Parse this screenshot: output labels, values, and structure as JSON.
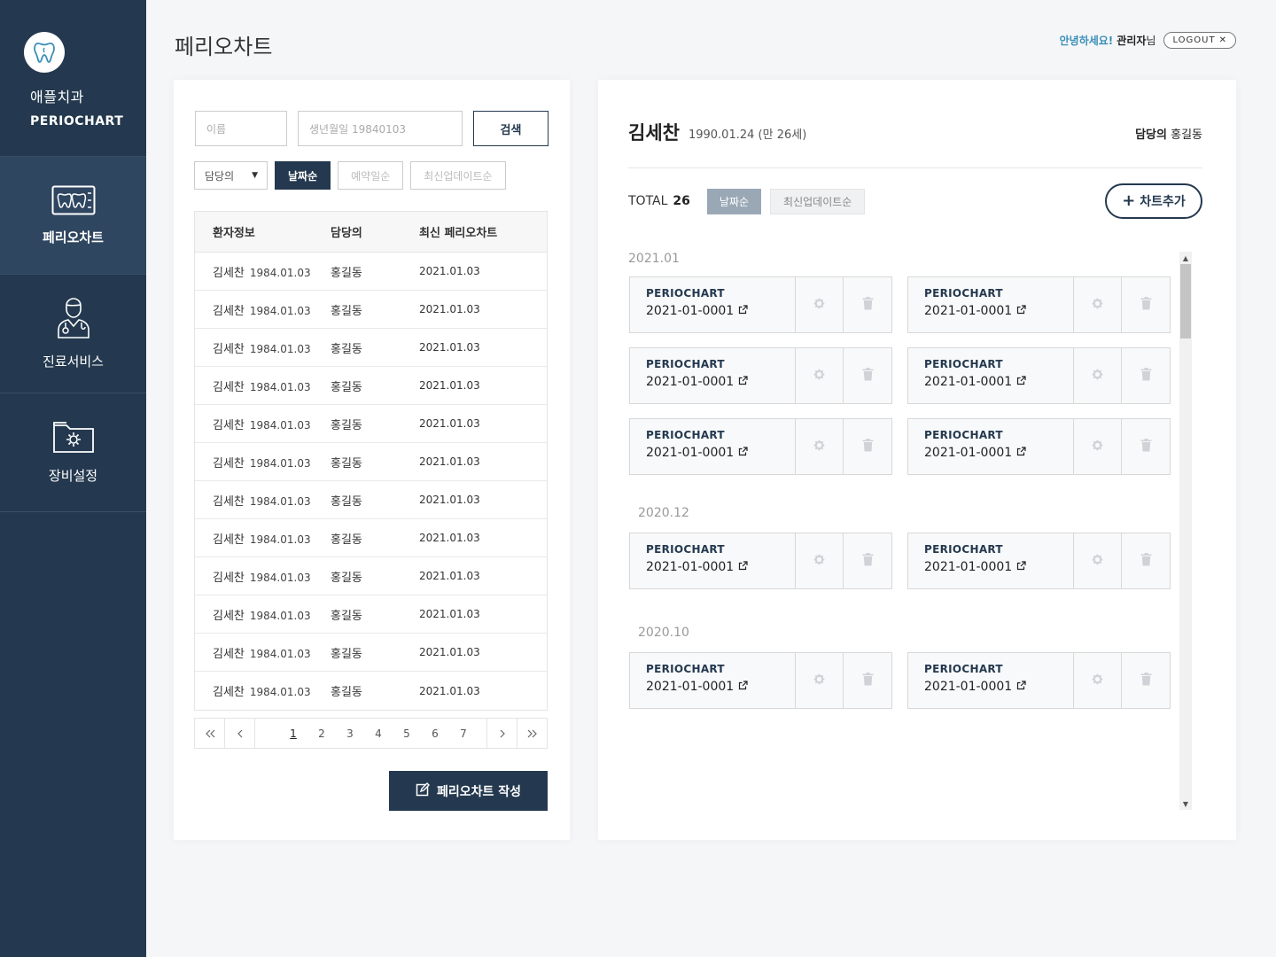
{
  "sidebar": {
    "brand_name": "애플치과",
    "brand_sub": "PERIOCHART",
    "items": [
      {
        "label": "페리오차트",
        "icon": "teeth-chart-icon"
      },
      {
        "label": "진료서비스",
        "icon": "doctor-icon"
      },
      {
        "label": "장비설정",
        "icon": "settings-folder-icon"
      }
    ]
  },
  "header": {
    "title": "페리오차트",
    "greeting": "안녕하세요!",
    "user_name": "관리자",
    "user_suffix": "님",
    "logout": "LOGOUT"
  },
  "search": {
    "name_placeholder": "이름",
    "birth_placeholder": "생년월일 19840103",
    "search_label": "검색",
    "doctor_select": "담당의",
    "sort_date": "날짜순",
    "sort_appointment": "예약일순",
    "sort_updated": "최신업데이트순"
  },
  "table": {
    "headers": [
      "환자정보",
      "담당의",
      "최신 페리오차트"
    ],
    "rows": [
      {
        "name": "김세찬",
        "birth": "1984.01.03",
        "doctor": "홍길동",
        "latest": "2021.01.03"
      },
      {
        "name": "김세찬",
        "birth": "1984.01.03",
        "doctor": "홍길동",
        "latest": "2021.01.03"
      },
      {
        "name": "김세찬",
        "birth": "1984.01.03",
        "doctor": "홍길동",
        "latest": "2021.01.03"
      },
      {
        "name": "김세찬",
        "birth": "1984.01.03",
        "doctor": "홍길동",
        "latest": "2021.01.03"
      },
      {
        "name": "김세찬",
        "birth": "1984.01.03",
        "doctor": "홍길동",
        "latest": "2021.01.03"
      },
      {
        "name": "김세찬",
        "birth": "1984.01.03",
        "doctor": "홍길동",
        "latest": "2021.01.03"
      },
      {
        "name": "김세찬",
        "birth": "1984.01.03",
        "doctor": "홍길동",
        "latest": "2021.01.03"
      },
      {
        "name": "김세찬",
        "birth": "1984.01.03",
        "doctor": "홍길동",
        "latest": "2021.01.03"
      },
      {
        "name": "김세찬",
        "birth": "1984.01.03",
        "doctor": "홍길동",
        "latest": "2021.01.03"
      },
      {
        "name": "김세찬",
        "birth": "1984.01.03",
        "doctor": "홍길동",
        "latest": "2021.01.03"
      },
      {
        "name": "김세찬",
        "birth": "1984.01.03",
        "doctor": "홍길동",
        "latest": "2021.01.03"
      },
      {
        "name": "김세찬",
        "birth": "1984.01.03",
        "doctor": "홍길동",
        "latest": "2021.01.03"
      }
    ]
  },
  "pagination": {
    "first": "«",
    "prev": "‹",
    "next": "›",
    "last": "»",
    "pages": [
      "1",
      "2",
      "3",
      "4",
      "5",
      "6",
      "7"
    ],
    "current": "1"
  },
  "write_button": "페리오차트 작성",
  "patient": {
    "name": "김세찬",
    "birth_age": "1990.01.24 (만 26세)",
    "doctor_label": "담당의",
    "doctor_name": "홍길동"
  },
  "chart_list": {
    "total_label": "TOTAL",
    "total_count": "26",
    "sort_date": "날짜순",
    "sort_updated": "최신업데이트순",
    "add_label": "차트추가",
    "groups": [
      {
        "label": "2021.01",
        "cards": [
          {
            "title": "PERIOCHART",
            "code": "2021-01-0001"
          },
          {
            "title": "PERIOCHART",
            "code": "2021-01-0001"
          },
          {
            "title": "PERIOCHART",
            "code": "2021-01-0001"
          },
          {
            "title": "PERIOCHART",
            "code": "2021-01-0001"
          },
          {
            "title": "PERIOCHART",
            "code": "2021-01-0001"
          },
          {
            "title": "PERIOCHART",
            "code": "2021-01-0001"
          }
        ]
      },
      {
        "label": "2020.12",
        "cards": [
          {
            "title": "PERIOCHART",
            "code": "2021-01-0001"
          },
          {
            "title": "PERIOCHART",
            "code": "2021-01-0001"
          }
        ]
      },
      {
        "label": "2020.10",
        "cards": [
          {
            "title": "PERIOCHART",
            "code": "2021-01-0001"
          },
          {
            "title": "PERIOCHART",
            "code": "2021-01-0001"
          }
        ]
      }
    ]
  },
  "colors": {
    "sidebar": "#24394f",
    "sidebar_active": "#2f4660",
    "accent": "#3a8fb7",
    "primary": "#24394f"
  }
}
